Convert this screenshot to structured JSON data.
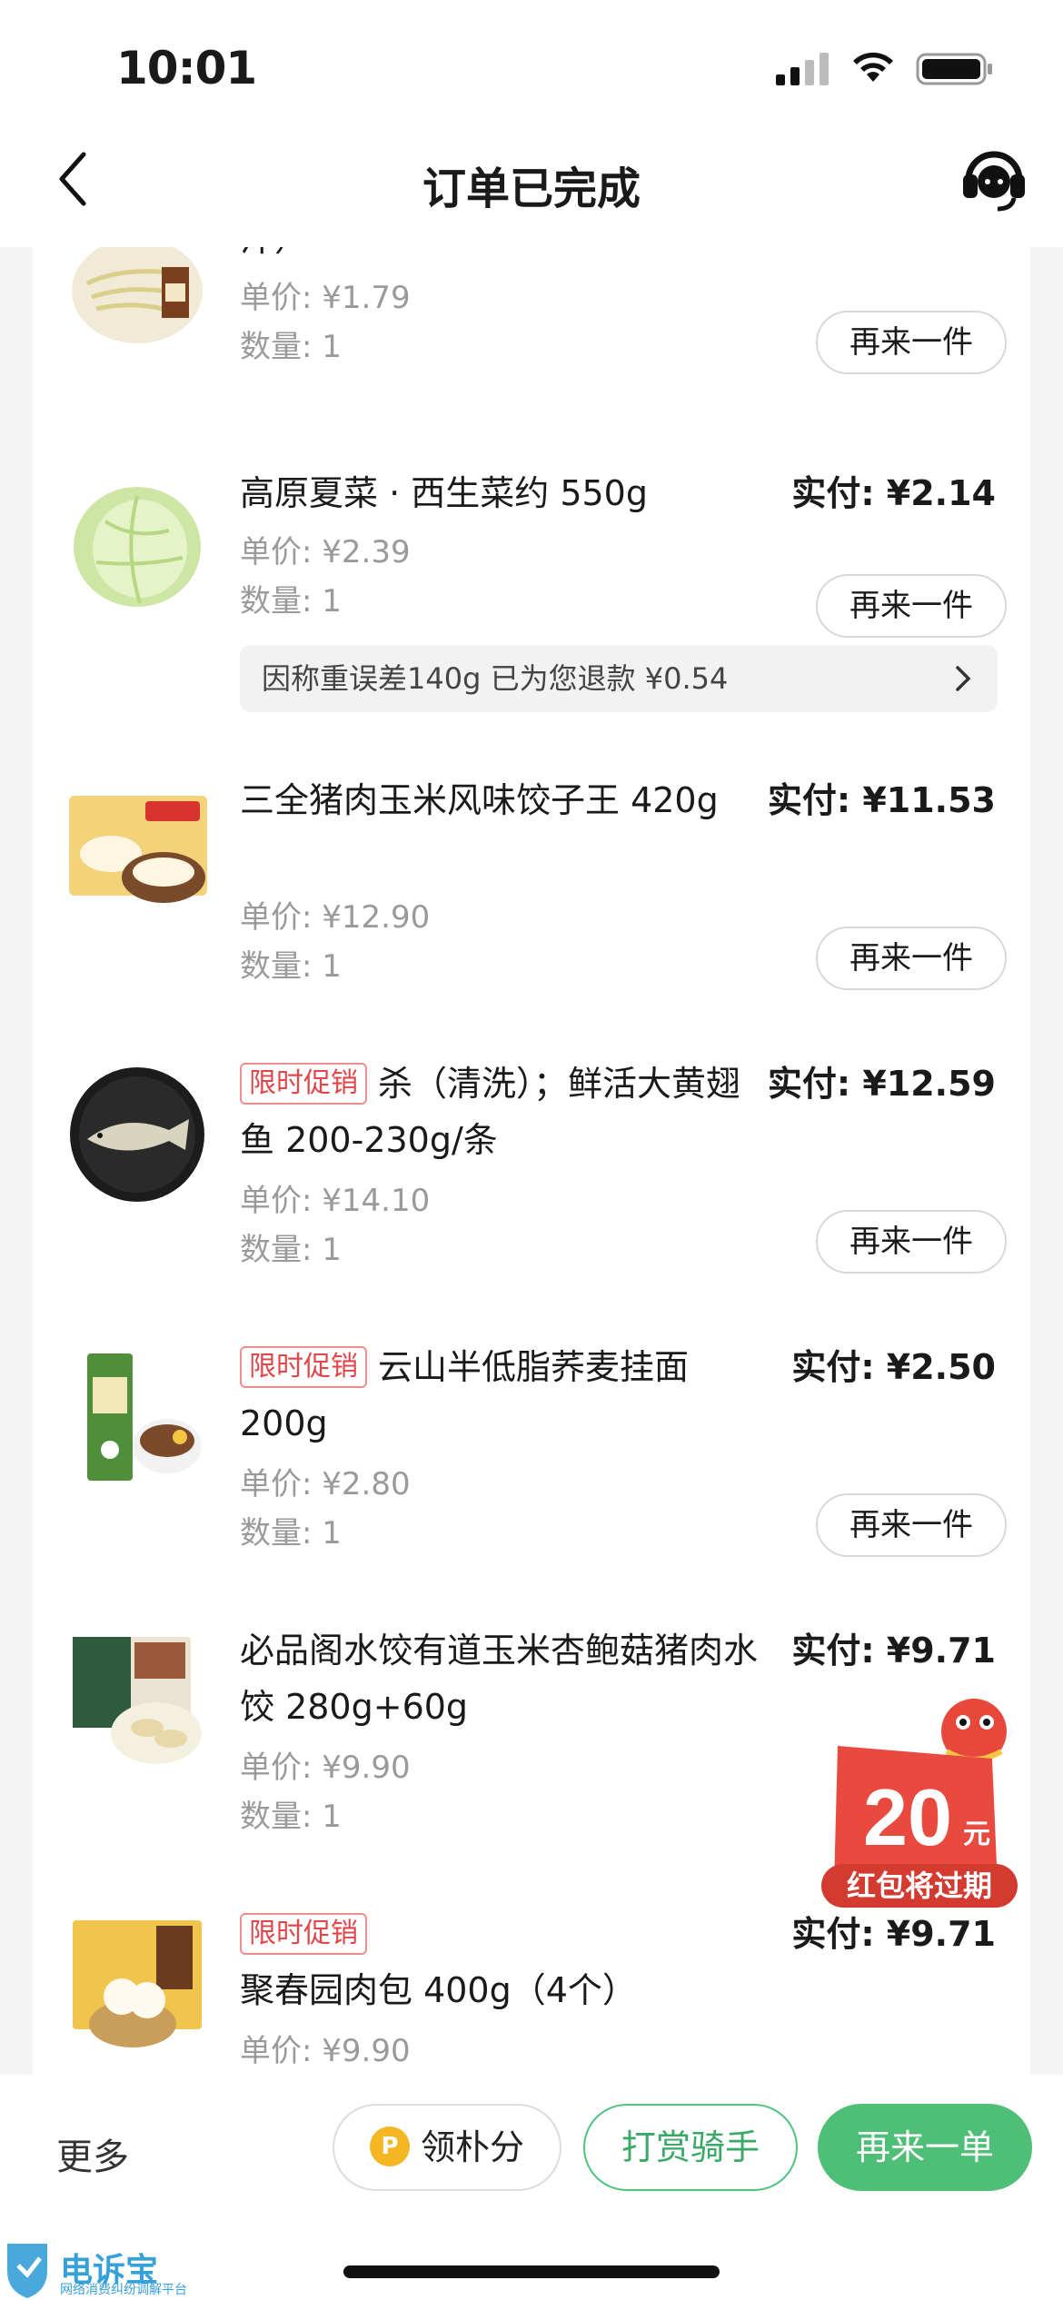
{
  "status_bar": {
    "time": "10:01"
  },
  "header": {
    "title": "订单已完成"
  },
  "items": [
    {
      "name_tail": "汁）",
      "unit_price": "单价: ¥1.79",
      "qty": "数量: 1",
      "again": "再来一件"
    },
    {
      "name": "高原夏菜 · 西生菜约 550g",
      "paid": "实付: ¥2.14",
      "unit_price": "单价: ¥2.39",
      "qty": "数量: 1",
      "again": "再来一件",
      "refund": "因称重误差140g 已为您退款 ¥0.54"
    },
    {
      "name": "三全猪肉玉米风味饺子王 420g",
      "paid": "实付: ¥11.53",
      "unit_price": "单价: ¥12.90",
      "qty": "数量: 1",
      "again": "再来一件"
    },
    {
      "tag": "限时促销",
      "name": "杀（清洗）；鲜活大黄翅鱼 200-230g/条",
      "paid": "实付: ¥12.59",
      "unit_price": "单价: ¥14.10",
      "qty": "数量: 1",
      "again": "再来一件"
    },
    {
      "tag": "限时促销",
      "name": "云山半低脂荞麦挂面 200g",
      "paid": "实付: ¥2.50",
      "unit_price": "单价: ¥2.80",
      "qty": "数量: 1",
      "again": "再来一件"
    },
    {
      "name": "必品阁水饺有道玉米杏鲍菇猪肉水饺 280g+60g",
      "paid": "实付: ¥9.71",
      "unit_price": "单价: ¥9.90",
      "qty": "数量: 1"
    },
    {
      "tag": "限时促销",
      "name": "聚春园肉包 400g（4个）",
      "paid": "实付: ¥9.71",
      "unit_price": "单价: ¥9.90"
    }
  ],
  "red_packet": {
    "amount": "20",
    "unit": "元",
    "label": "红包将过期"
  },
  "bottom_bar": {
    "more": "更多",
    "points": "领朴分",
    "tip_rider": "打赏骑手",
    "reorder": "再来一单"
  },
  "watermark": {
    "brand": "电诉宝",
    "sub": "网络消费纠纷调解平台"
  },
  "colors": {
    "accent_green": "#4fbf77",
    "promo_red": "#e0454a"
  }
}
